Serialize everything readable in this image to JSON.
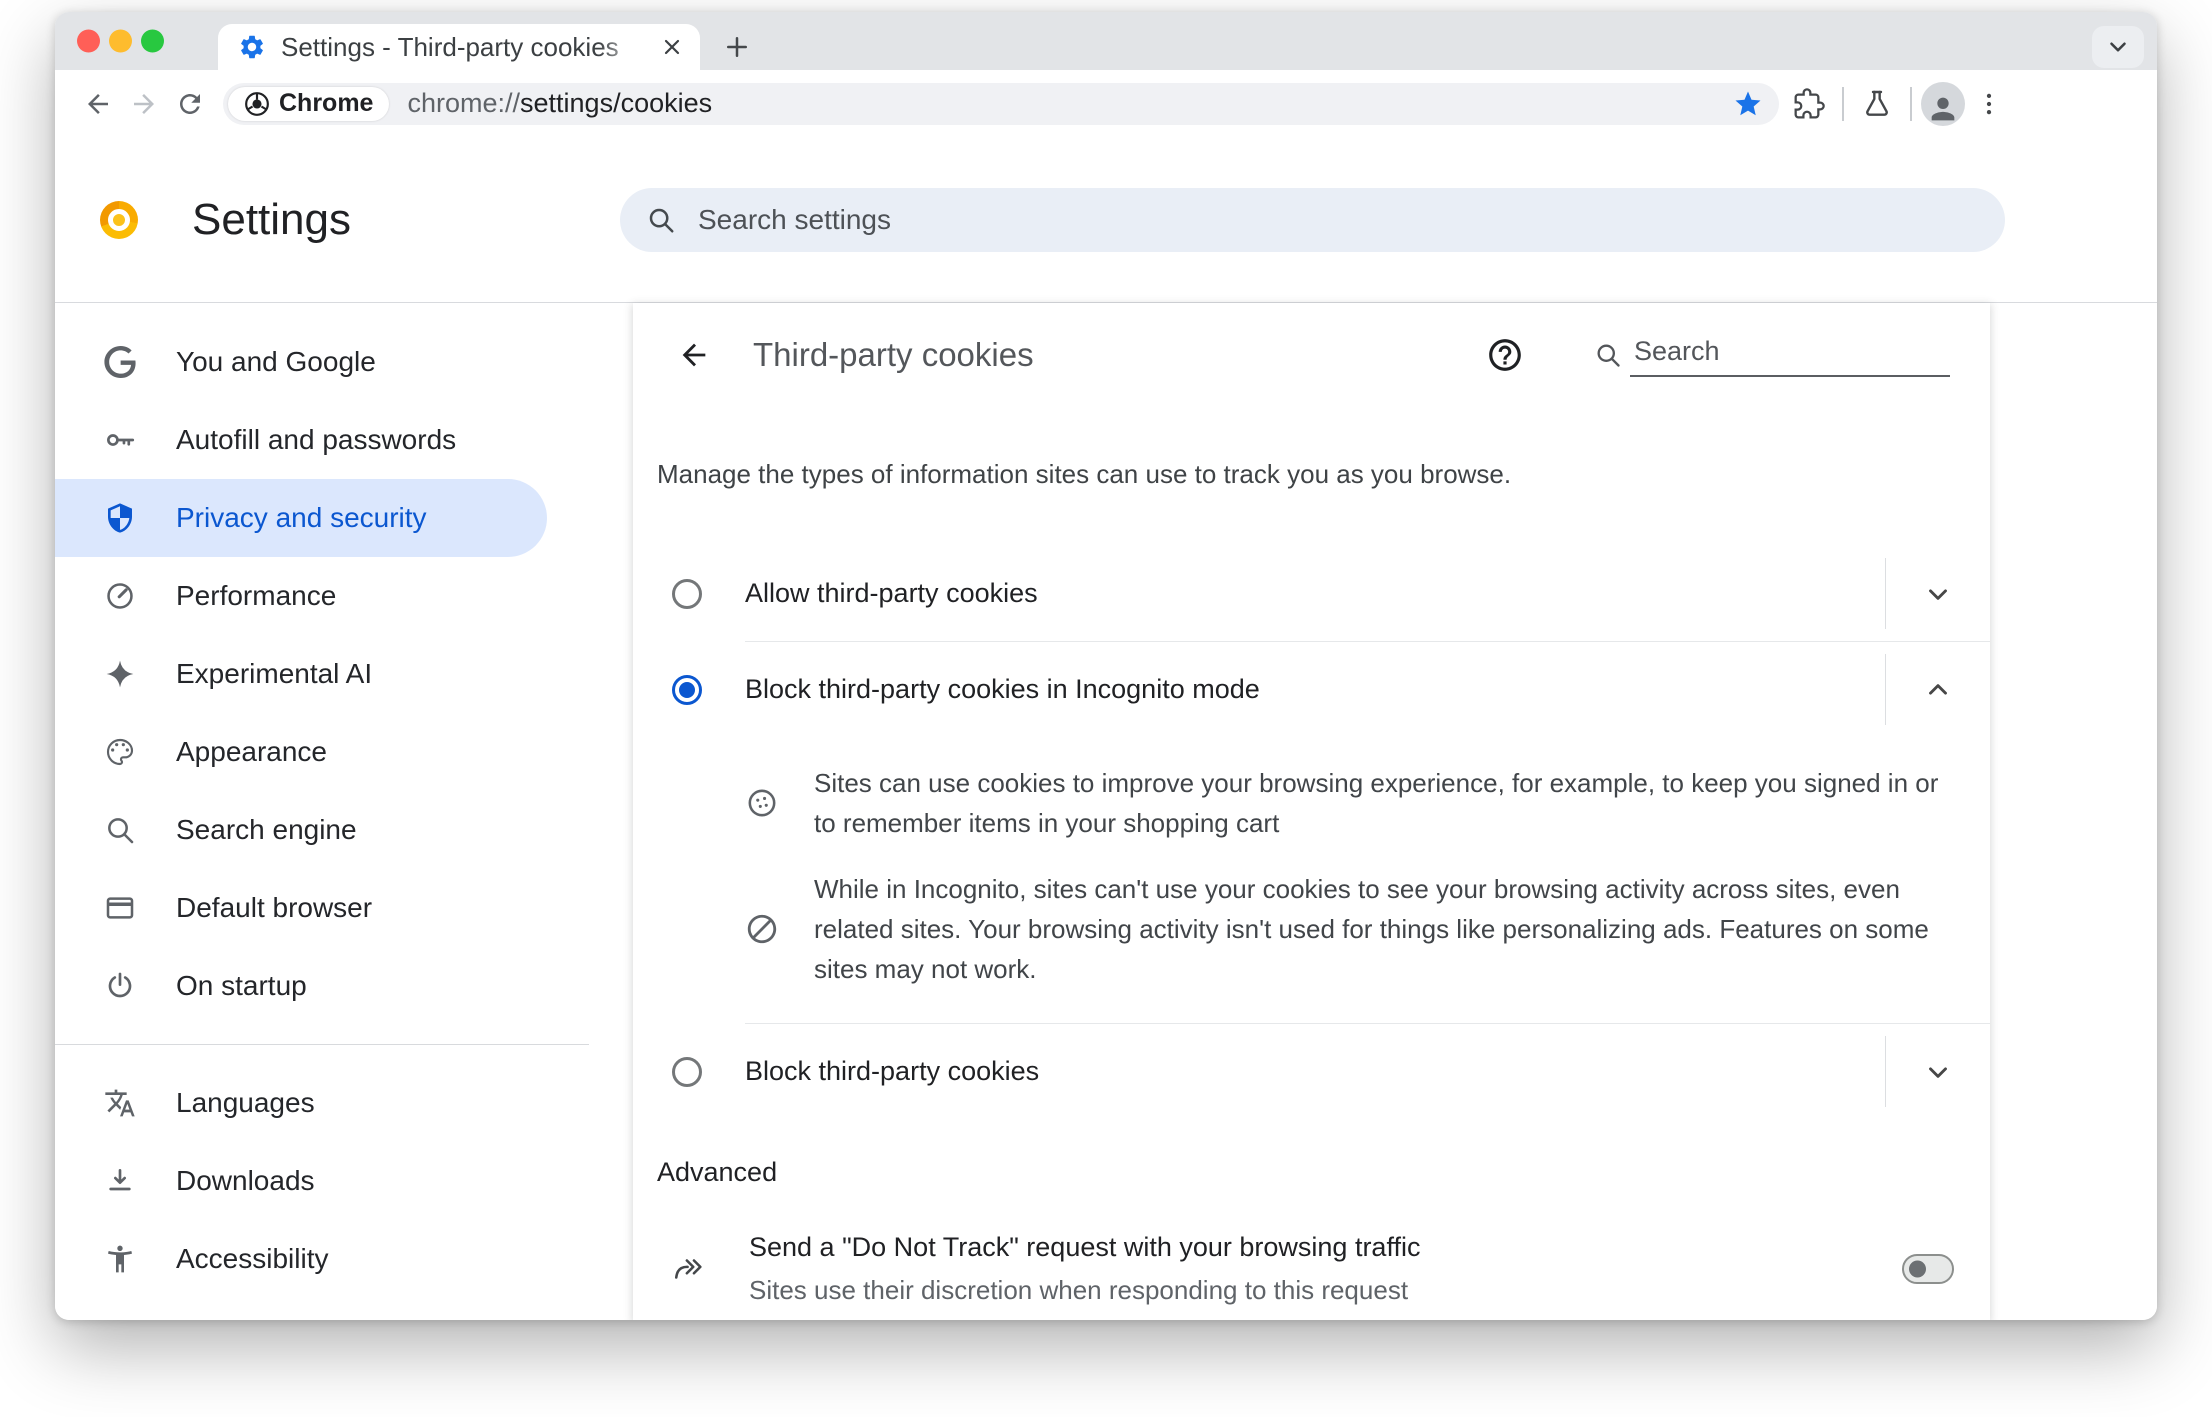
{
  "colors": {
    "accent_blue": "#1a73e8",
    "selected_blue": "#0b57d0",
    "sidebar_selected_bg": "#dbe7fd",
    "tabstrip_bg": "#e2e4e7"
  },
  "browser": {
    "tab": {
      "title": "Settings - Third-party cookies"
    },
    "toolbar": {
      "site_chip_label": "Chrome",
      "url_scheme": "chrome://",
      "url_path": "settings/cookies"
    }
  },
  "settings_header": {
    "title": "Settings",
    "search_placeholder": "Search settings"
  },
  "sidebar": {
    "items": [
      {
        "label": "You and Google"
      },
      {
        "label": "Autofill and passwords"
      },
      {
        "label": "Privacy and security"
      },
      {
        "label": "Performance"
      },
      {
        "label": "Experimental AI"
      },
      {
        "label": "Appearance"
      },
      {
        "label": "Search engine"
      },
      {
        "label": "Default browser"
      },
      {
        "label": "On startup"
      },
      {
        "label": "Languages"
      },
      {
        "label": "Downloads"
      },
      {
        "label": "Accessibility"
      }
    ],
    "selected_index": 2
  },
  "content": {
    "title": "Third-party cookies",
    "search_placeholder": "Search",
    "intro": "Manage the types of information sites can use to track you as you browse.",
    "options": [
      {
        "label": "Allow third-party cookies",
        "selected": false,
        "expanded": false
      },
      {
        "label": "Block third-party cookies in Incognito mode",
        "selected": true,
        "expanded": true,
        "details": [
          "Sites can use cookies to improve your browsing experience, for example, to keep you signed in or to remember items in your shopping cart",
          "While in Incognito, sites can't use your cookies to see your browsing activity across sites, even related sites. Your browsing activity isn't used for things like personalizing ads. Features on some sites may not work."
        ]
      },
      {
        "label": "Block third-party cookies",
        "selected": false,
        "expanded": false
      }
    ],
    "advanced_label": "Advanced",
    "do_not_track": {
      "title": "Send a \"Do Not Track\" request with your browsing traffic",
      "subtitle": "Sites use their discretion when responding to this request",
      "enabled": false
    }
  }
}
